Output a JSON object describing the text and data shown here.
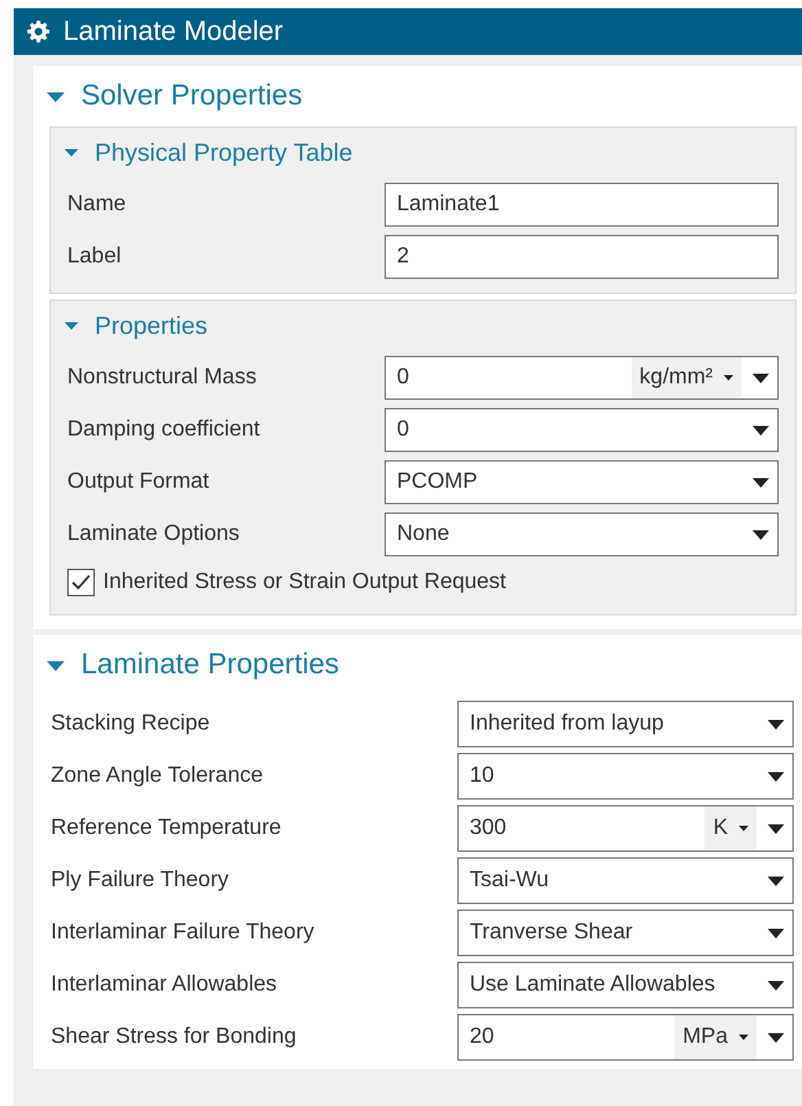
{
  "window": {
    "title": "Laminate Modeler"
  },
  "sections": [
    {
      "title": "Solver Properties",
      "expanded": true,
      "groups": [
        {
          "title": "Physical Property Table",
          "expanded": true,
          "fields": [
            {
              "kind": "text",
              "label": "Name",
              "value": "Laminate1"
            },
            {
              "kind": "text",
              "label": "Label",
              "value": "2"
            }
          ]
        },
        {
          "title": "Properties",
          "expanded": true,
          "fields": [
            {
              "kind": "unit",
              "label": "Nonstructural Mass",
              "value": "0",
              "unit": "kg/mm²"
            },
            {
              "kind": "dropdown",
              "label": "Damping coefficient",
              "value": "0"
            },
            {
              "kind": "dropdown",
              "label": "Output Format",
              "value": "PCOMP"
            },
            {
              "kind": "dropdown",
              "label": "Laminate Options",
              "value": "None"
            },
            {
              "kind": "checkbox",
              "label": "Inherited Stress or Strain Output Request",
              "checked": true
            }
          ]
        }
      ]
    },
    {
      "title": "Laminate Properties",
      "expanded": true,
      "fields": [
        {
          "kind": "dropdown",
          "label": "Stacking Recipe",
          "value": "Inherited from layup"
        },
        {
          "kind": "dropdown",
          "label": "Zone Angle Tolerance",
          "value": "10"
        },
        {
          "kind": "unit",
          "label": "Reference Temperature",
          "value": "300",
          "unit": "K"
        },
        {
          "kind": "dropdown",
          "label": "Ply Failure Theory",
          "value": "Tsai-Wu"
        },
        {
          "kind": "dropdown",
          "label": "Interlaminar Failure Theory",
          "value": "Tranverse Shear"
        },
        {
          "kind": "dropdown",
          "label": "Interlaminar Allowables",
          "value": "Use Laminate Allowables"
        },
        {
          "kind": "unit",
          "label": "Shear Stress for Bonding",
          "value": "20",
          "unit": "MPa"
        }
      ]
    }
  ]
}
